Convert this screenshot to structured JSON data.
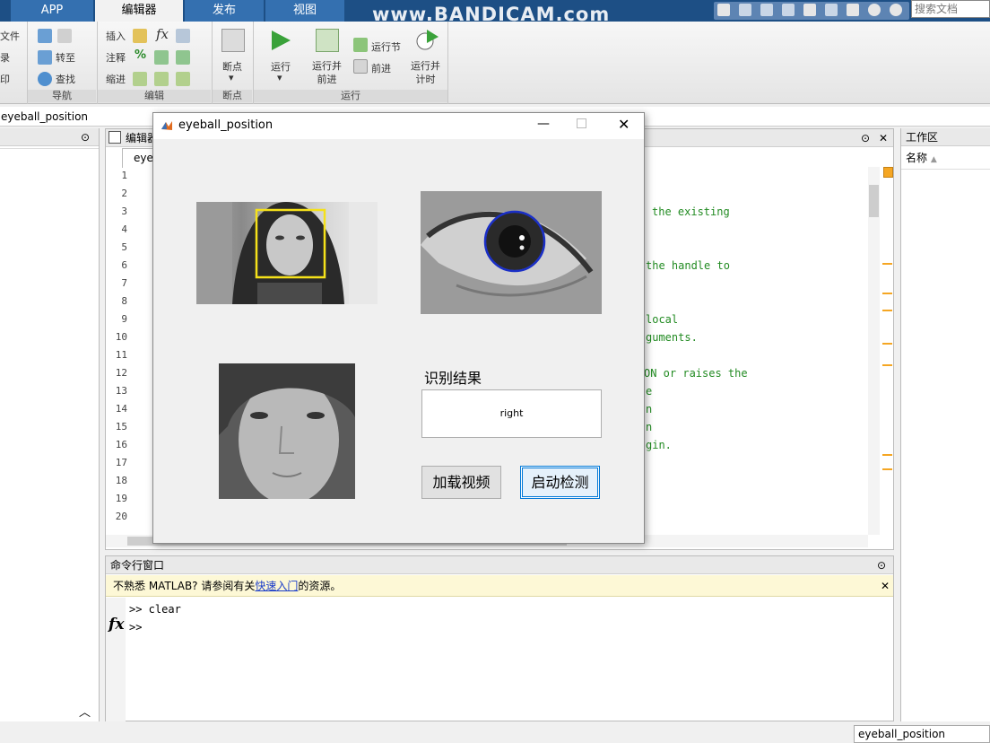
{
  "tabs": [
    {
      "label": "APP",
      "active": false
    },
    {
      "label": "编辑器",
      "active": true
    },
    {
      "label": "发布",
      "active": false
    },
    {
      "label": "视图",
      "active": false
    }
  ],
  "watermark": "www.BANDICAM.com",
  "search": {
    "placeholder": "搜索文档"
  },
  "ribbon": {
    "file_partial": [
      "文件",
      "录",
      "印"
    ],
    "nav": {
      "goto": "转至",
      "find": "查找",
      "title": "导航"
    },
    "edit": {
      "insert": "插入",
      "comment": "注释",
      "indent": "缩进",
      "title": "编辑"
    },
    "breakpoint": {
      "label": "断点",
      "title": "断点"
    },
    "run": {
      "run": "运行",
      "run_advance": "运行并\n前进",
      "run_section": "运行节",
      "advance": "前进",
      "run_time": "运行并\n计时",
      "title": "运行"
    }
  },
  "address": "eyeball_position",
  "editor": {
    "header": "编辑器",
    "tab": "eye",
    "line_numbers": [
      "1",
      "2",
      "3",
      "4",
      "5",
      "6",
      "7",
      "8",
      "9",
      "10",
      "11",
      "12",
      "13",
      "14",
      "15",
      "16",
      "17",
      "18",
      "19",
      "20"
    ],
    "code_fragments": [
      {
        "line": 3,
        "text": "the existing"
      },
      {
        "line": 6,
        "text": "the handle to"
      },
      {
        "line": 9,
        "text": "local"
      },
      {
        "line": 10,
        "text": "guments."
      },
      {
        "line": 12,
        "text": "ON or raises the"
      },
      {
        "line": 13,
        "text": "e"
      },
      {
        "line": 14,
        "text": "n"
      },
      {
        "line": 15,
        "text": "n"
      },
      {
        "line": 16,
        "text": "gin."
      }
    ]
  },
  "workspace": {
    "header": "工作区",
    "column": "名称"
  },
  "command_window": {
    "header": "命令行窗口",
    "notice_pre": "不熟悉 MATLAB? 请参阅有关",
    "notice_link": "快速入门",
    "notice_post": "的资源。",
    "line1": ">> clear",
    "prompt": ">>",
    "fx": "fx"
  },
  "status": {
    "label": "eyeball_position"
  },
  "figure": {
    "title": "eyeball_position",
    "result_label": "识别结果",
    "result_value": "right",
    "load_button": "加载视频",
    "start_button": "启动检测"
  }
}
